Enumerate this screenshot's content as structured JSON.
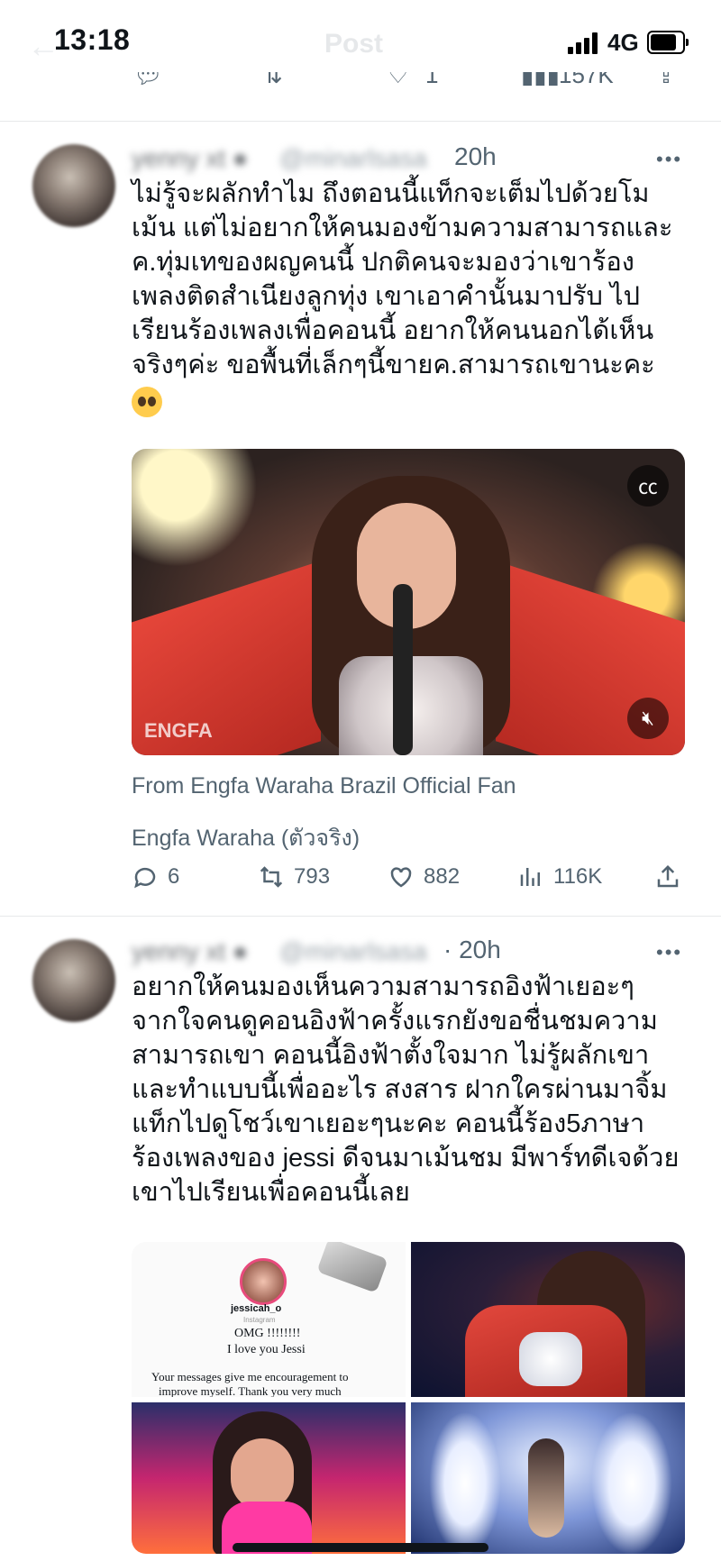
{
  "status_bar": {
    "time": "13:18",
    "network": "4G"
  },
  "nav": {
    "title": "Post",
    "back_icon": "←"
  },
  "prev_actions": {
    "reply": "",
    "retweet": "",
    "like": "1",
    "views": "157K",
    "share": ""
  },
  "tweets": [
    {
      "time": "20h",
      "more": "•••",
      "lines": [
        "ไม่รู้จะผลักทำไม ถึงตอนนี้แท็กจะเต็มไปด้วยโม",
        "เม้น แต่ไม่อยากให้คนมองข้ามความสามารถและ",
        "ค.ทุ่มเทของผญคนนี้ ปกติคนจะมองว่าเขาร้อง",
        "เพลงติดสำเนียงลูกทุ่ง เขาเอาคำนั้นมาปรับ ไป",
        "เรียนร้องเพลงเพื่อคอนนี้ อยากให้คนนอกได้เห็น",
        "จริงๆค่ะ ขอพื้นที่เล็กๆนี้ขายค.สามารถเขานะคะ"
      ],
      "video_watermark": "ENGFA",
      "video_caption": "From Engfa Waraha Brazil Official Fan",
      "video_title": "Engfa Waraha (ตัวจริง)",
      "actions": {
        "replies": "6",
        "retweets": "793",
        "likes": "882",
        "views": "116K"
      }
    },
    {
      "time": "· 20h",
      "more": "•••",
      "lines": [
        "อยากให้คนมองเห็นความสามารถอิงฟ้าเยอะๆ",
        "จากใจคนดูคอนอิงฟ้าครั้งแรกยังขอชื่นชมความ",
        "สามารถเขา คอนนี้อิงฟ้าตั้งใจมาก ไม่รู้ผลักเขา",
        "และทำแบบนี้เพื่ออะไร สงสาร ฝากใครผ่านมาจิ้ม",
        "แท็กไปดูโชว์เขาเยอะๆนะคะ คอนนี้ร้อง5ภาษา",
        "ร้องเพลงของ jessi ดีจนมาเม้นชม มีพาร์ทดีเจด้วย",
        "เขาไปเรียนเพื่อคอนนี้เลย"
      ],
      "insta": {
        "handle": "jessicah_o",
        "platform": "Instagram",
        "msg1": "OMG !!!!!!!!",
        "msg2": "I love you Jessi",
        "msg3": "Your messages give me encouragement to",
        "msg4": "improve myself. Thank you very much"
      }
    }
  ]
}
